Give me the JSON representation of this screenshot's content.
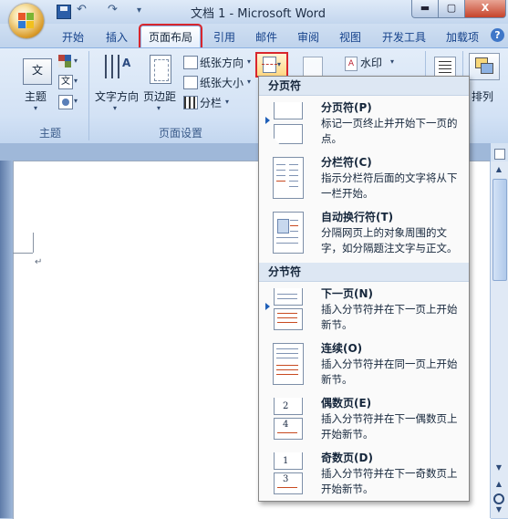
{
  "window": {
    "title": "文档 1 - Microsoft Word",
    "min_label": "▬",
    "max_label": "▢",
    "close_label": "X"
  },
  "qat": {
    "undo": "↶",
    "redo": "↷",
    "more": "▾"
  },
  "tabs": [
    {
      "label": "开始"
    },
    {
      "label": "插入"
    },
    {
      "label": "页面布局",
      "active": true
    },
    {
      "label": "引用"
    },
    {
      "label": "邮件"
    },
    {
      "label": "审阅"
    },
    {
      "label": "视图"
    },
    {
      "label": "开发工具"
    },
    {
      "label": "加载项"
    }
  ],
  "help_label": "?",
  "ribbon": {
    "theme": {
      "label": "主题",
      "group_label": "主题",
      "icon_text": "文"
    },
    "theme_font_icon_text": "文",
    "text_direction": {
      "label": "文字方向"
    },
    "margins": {
      "label": "页边距"
    },
    "orientation": {
      "label": "纸张方向"
    },
    "size": {
      "label": "纸张大小"
    },
    "columns": {
      "label": "分栏"
    },
    "page_setup_group": "页面设置",
    "watermark": {
      "label": "水印",
      "icon_text": "A"
    },
    "arrange": {
      "label": "排列"
    },
    "chev": "▾"
  },
  "document": {
    "para_mark": "↵"
  },
  "scrollbar": {
    "up": "▲",
    "down": "▼",
    "prev": "▲",
    "next": "▼"
  },
  "breaks_menu": {
    "page_breaks_header": "分页符",
    "section_breaks_header": "分节符",
    "items": [
      {
        "title": "分页符(P)",
        "desc": "标记一页终止并开始下一页的点。"
      },
      {
        "title": "分栏符(C)",
        "desc": "指示分栏符后面的文字将从下一栏开始。"
      },
      {
        "title": "自动换行符(T)",
        "desc": "分隔网页上的对象周围的文字，如分隔题注文字与正文。"
      },
      {
        "title": "下一页(N)",
        "desc": "插入分节符并在下一页上开始新节。"
      },
      {
        "title": "连续(O)",
        "desc": "插入分节符并在同一页上开始新节。"
      },
      {
        "title": "偶数页(E)",
        "desc": "插入分节符并在下一偶数页上开始新节。",
        "num": "2",
        "num2": "4"
      },
      {
        "title": "奇数页(D)",
        "desc": "插入分节符并在下一奇数页上开始新节。",
        "num": "1",
        "num2": "3"
      }
    ]
  }
}
